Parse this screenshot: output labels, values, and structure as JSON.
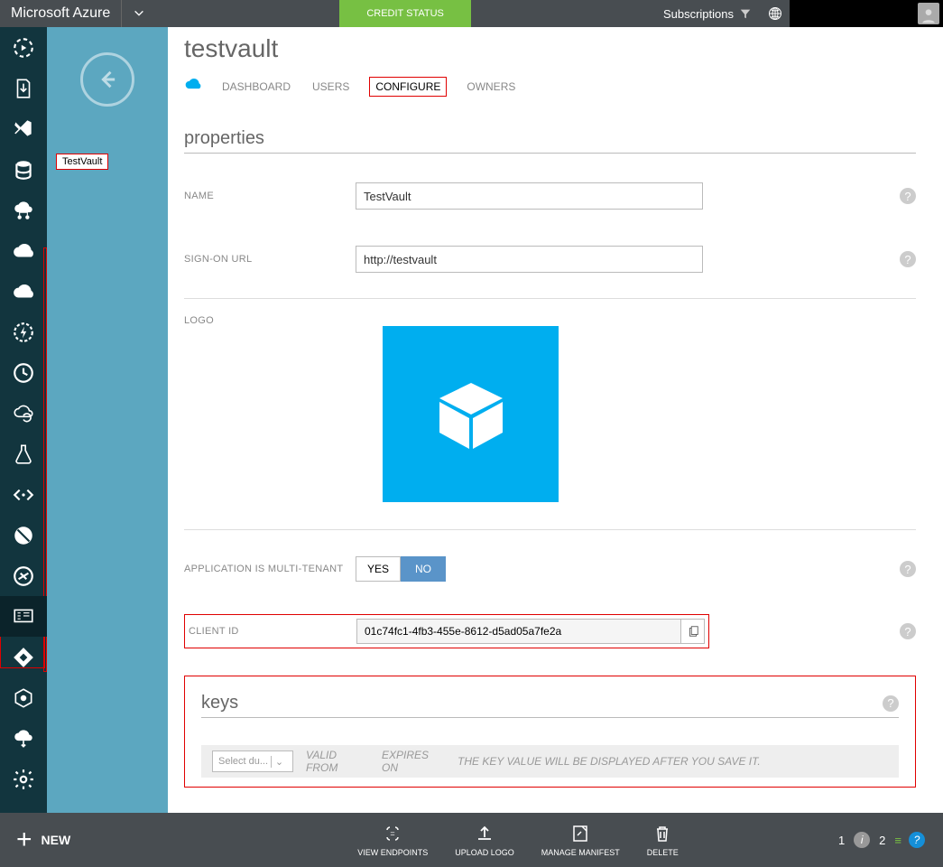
{
  "topbar": {
    "brand": "Microsoft Azure",
    "credit": "CREDIT STATUS",
    "subscriptions": "Subscriptions"
  },
  "blade": {
    "label": "TestVault"
  },
  "page": {
    "title": "testvault"
  },
  "tabs": {
    "dashboard": "DASHBOARD",
    "users": "USERS",
    "configure": "CONFIGURE",
    "owners": "OWNERS"
  },
  "sections": {
    "properties": "properties",
    "keys": "keys"
  },
  "labels": {
    "name": "NAME",
    "signon": "SIGN-ON URL",
    "logo": "LOGO",
    "multitenant": "APPLICATION IS MULTI-TENANT",
    "clientid": "CLIENT ID"
  },
  "values": {
    "name": "TestVault",
    "signon": "http://testvault",
    "clientid": "01c74fc1-4fb3-455e-8612-d5ad05a7fe2a"
  },
  "toggle": {
    "yes": "YES",
    "no": "NO"
  },
  "keys": {
    "select": "Select du...",
    "validfrom": "VALID FROM",
    "expireson": "EXPIRES ON",
    "hint": "THE KEY VALUE WILL BE DISPLAYED AFTER YOU SAVE IT."
  },
  "bottombar": {
    "new": "NEW",
    "endpoints": "VIEW ENDPOINTS",
    "uploadlogo": "UPLOAD LOGO",
    "manifest": "MANAGE MANIFEST",
    "delete": "DELETE",
    "count1": "1",
    "count2": "2"
  }
}
